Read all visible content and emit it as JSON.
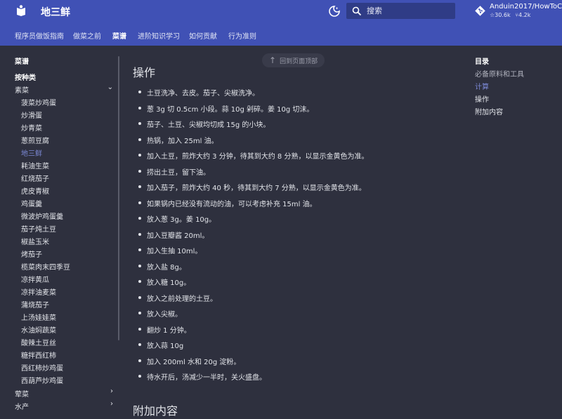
{
  "header": {
    "site_title": "地三鲜",
    "search_placeholder": "搜索",
    "repo_name": "Anduin2017/HowToCook",
    "repo_stars": "30.6k",
    "repo_forks": "4.2k"
  },
  "tabs": [
    "程序员做饭指南",
    "做菜之前",
    "菜谱",
    "进阶知识学习",
    "如何贡献",
    "行为准则"
  ],
  "sidebar": {
    "title": "菜谱",
    "section": "按种类",
    "group_vegetarian": "素菜",
    "items": [
      "菠菜炒鸡蛋",
      "炒滑蛋",
      "炒青菜",
      "葱煎豆腐",
      "地三鲜",
      "耗油生菜",
      "红烧茄子",
      "虎皮青椒",
      "鸡蛋羹",
      "微波炉鸡蛋羹",
      "茄子炖土豆",
      "椒盐玉米",
      "烤茄子",
      "榄菜肉末四季豆",
      "凉拌黄瓜",
      "凉拌油麦菜",
      "蒲烧茄子",
      "上汤娃娃菜",
      "水油焖蔬菜",
      "酸辣土豆丝",
      "糖拌西红柿",
      "西红柿炒鸡蛋",
      "西葫芦炒鸡蛋"
    ],
    "group_meat": "荤菜",
    "group_seafood": "水产"
  },
  "back_to_top": "回到页面顶部",
  "main": {
    "heading_ops": "操作",
    "steps": [
      "土豆洗净、去皮。茄子、尖椒洗净。",
      "葱 3g 切 0.5cm 小段。蒜 10g 剁碎。姜 10g 切沫。",
      "茄子、土豆、尖椒均切成 15g 的小块。",
      "热锅，加入 25ml 油。",
      "加入土豆，煎炸大约 3 分钟，待其到大约 8 分熟，以显示金黄色为准。",
      "捞出土豆，留下油。",
      "加入茄子，煎炸大约 40 秒，待其到大约 7 分熟，以显示金黄色为准。",
      "如果锅内已经没有流动的油，可以考虑补充 15ml 油。",
      "放入葱 3g。姜 10g。",
      "加入豆瓣酱 20ml。",
      "加入生抽 10ml。",
      "放入盐 8g。",
      "放入糖 10g。",
      "放入之前处理的土豆。",
      "放入尖椒。",
      "翻炒 1 分钟。",
      "放入蒜 10g",
      "加入 200ml 水和 20g 淀粉。",
      "待水开后，汤减少一半时，关火盛盘。"
    ],
    "heading_extra": "附加内容"
  },
  "toc": {
    "title": "目录",
    "items": [
      "必备原料和工具",
      "计算",
      "操作",
      "附加内容"
    ]
  }
}
